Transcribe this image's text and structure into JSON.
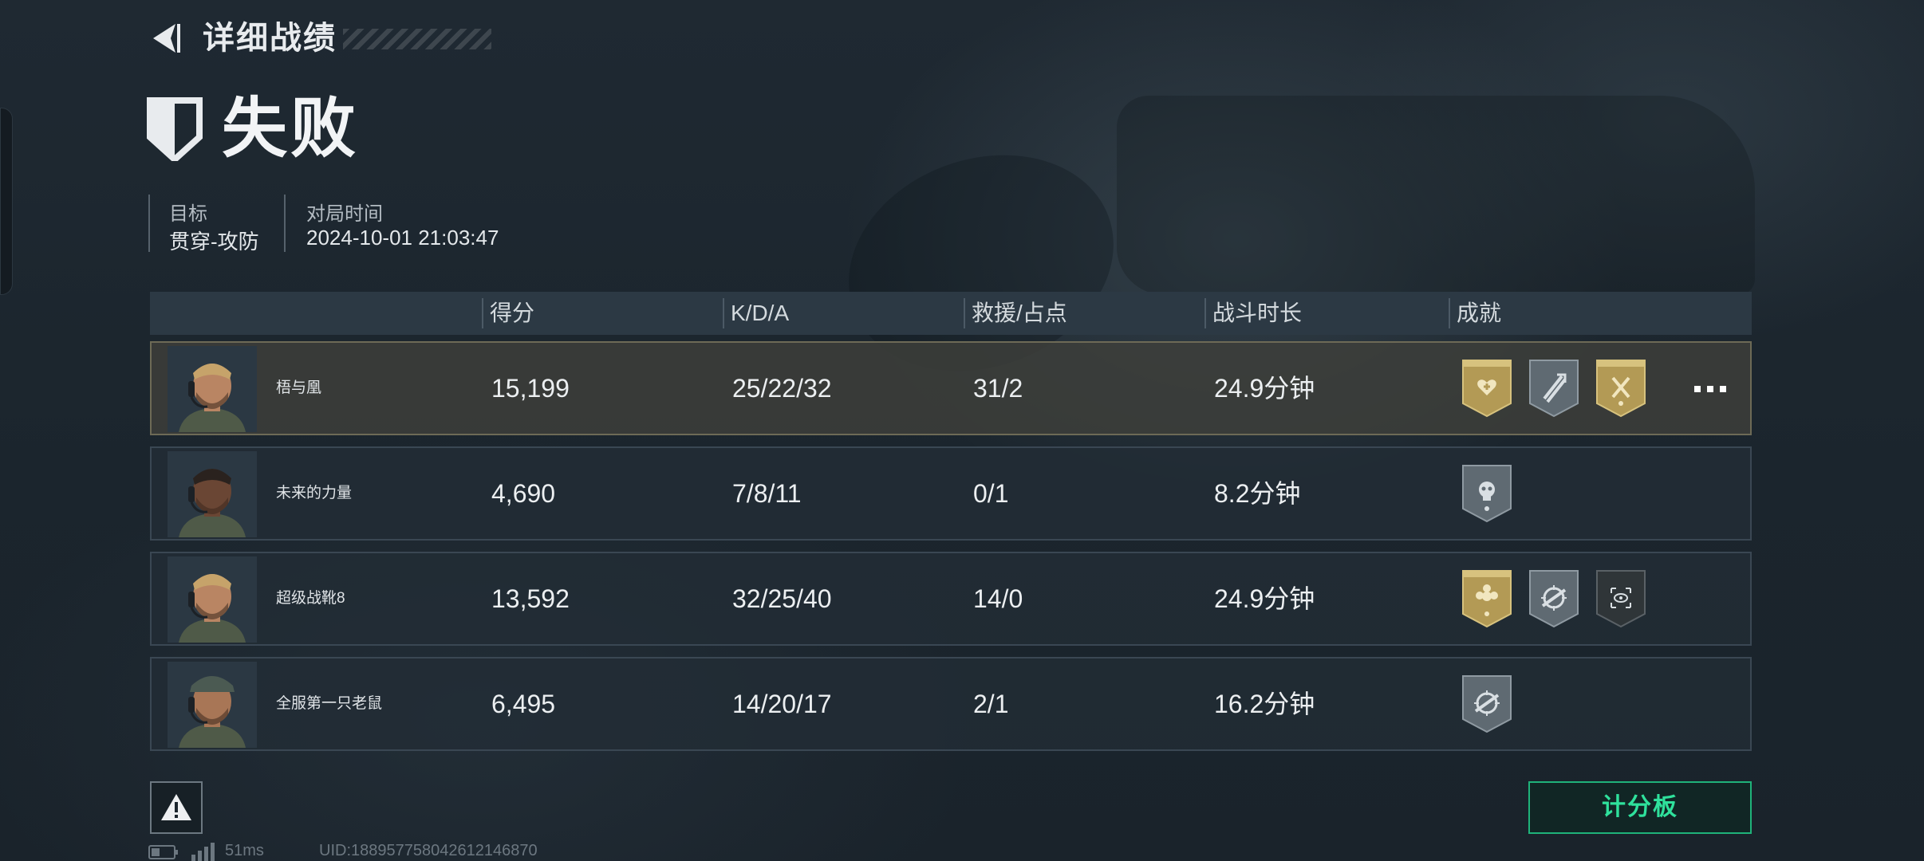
{
  "header": {
    "title": "详细战绩"
  },
  "result": {
    "text": "失败"
  },
  "meta": {
    "goal_label": "目标",
    "goal_value": "贯穿-攻防",
    "time_label": "对局时间",
    "time_value": "2024-10-01 21:03:47"
  },
  "table": {
    "columns": [
      "得分",
      "K/D/A",
      "救援/占点",
      "战斗时长",
      "成就"
    ],
    "rows": [
      {
        "name": "梧与凰",
        "score": "15,199",
        "kda": "25/22/32",
        "rescue": "31/2",
        "duration": "24.9分钟",
        "self": true,
        "badges": [
          "gold-heart-medal-icon",
          "silver-rank-chevron-icon",
          "gold-axe-medal-icon"
        ]
      },
      {
        "name": "未来的力量",
        "score": "4,690",
        "kda": "7/8/11",
        "rescue": "0/1",
        "duration": "8.2分钟",
        "self": false,
        "badges": [
          "silver-skull-badge-icon"
        ]
      },
      {
        "name": "超级战靴8",
        "score": "13,592",
        "kda": "32/25/40",
        "rescue": "14/0",
        "duration": "24.9分钟",
        "self": false,
        "badges": [
          "gold-flower-medal-icon",
          "silver-crosshair-gun-icon",
          "dark-target-eye-icon"
        ]
      },
      {
        "name": "全服第一只老鼠",
        "score": "6,495",
        "kda": "14/20/17",
        "rescue": "2/1",
        "duration": "16.2分钟",
        "self": false,
        "badges": [
          "silver-crosshair-gun-icon"
        ]
      }
    ]
  },
  "buttons": {
    "scoreboard": "计分板"
  },
  "status": {
    "ping": "51ms",
    "uid": "UID:1889577580426121468​70"
  },
  "colors": {
    "accent_green": "#2fe19c",
    "gold": "#b8a15a",
    "silver": "#6f7b84"
  }
}
